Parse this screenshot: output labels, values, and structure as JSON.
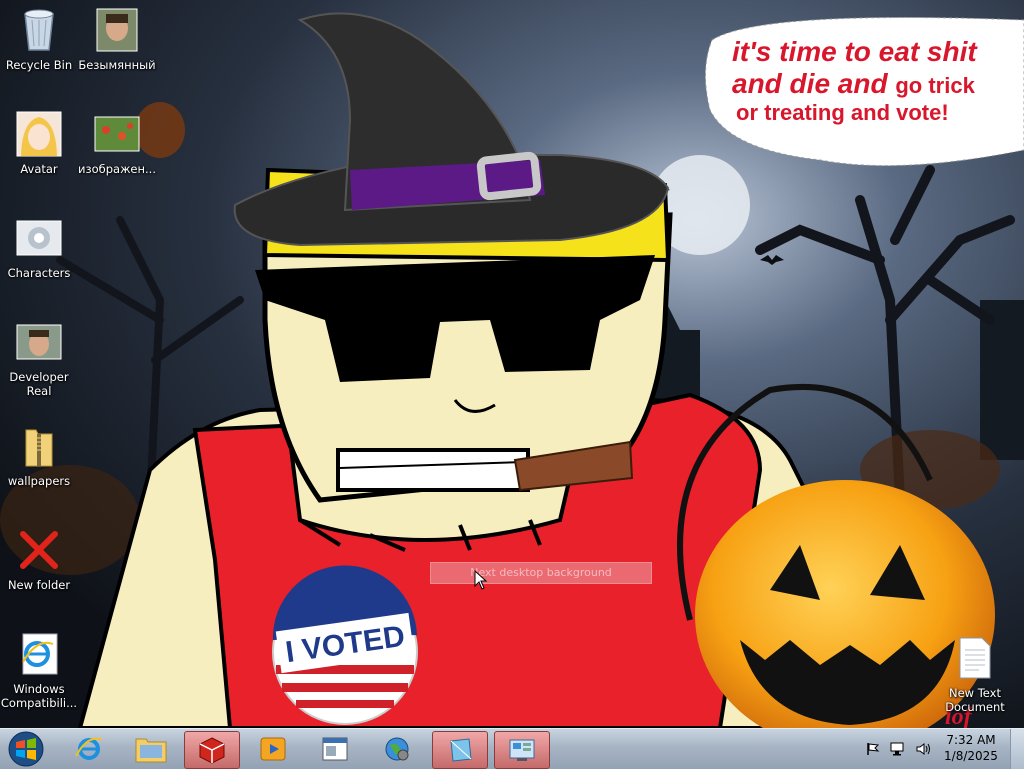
{
  "desktop": {
    "icons": [
      {
        "label": "Recycle Bin",
        "icon": "recycle-bin-icon"
      },
      {
        "label": "Безымянный",
        "icon": "photo-thumbnail-icon"
      },
      {
        "label": "Avatar",
        "icon": "anime-avatar-icon"
      },
      {
        "label": "изображен...",
        "icon": "photo-thumbnail-icon"
      },
      {
        "label": "Characters",
        "icon": "characters-icon"
      },
      {
        "label": "Developer Real",
        "icon": "photo-thumbnail-icon"
      },
      {
        "label": "wallpapers",
        "icon": "zip-folder-icon"
      },
      {
        "label": "New folder",
        "icon": "red-x-icon"
      },
      {
        "label": "Windows Compatibili...",
        "icon": "internet-explorer-icon"
      },
      {
        "label": "New Text Document",
        "icon": "text-document-icon"
      }
    ]
  },
  "wallpaper": {
    "bubble_line1": "it's time to eat shit",
    "bubble_line2_big": "and die and",
    "bubble_line2_small": "go trick",
    "bubble_line3": "or treating and vote!",
    "badge_text": "I VOTED",
    "logo_text": "lof"
  },
  "tooltip": {
    "text": "Next desktop background"
  },
  "taskbar": {
    "start_icon": "windows-logo-icon",
    "pinned": [
      {
        "name": "internet-explorer",
        "icon": "internet-explorer-icon",
        "active": false
      },
      {
        "name": "file-explorer",
        "icon": "folder-icon",
        "active": false
      },
      {
        "name": "app-red-cube",
        "icon": "red-cube-icon",
        "active": true
      },
      {
        "name": "media-player",
        "icon": "media-player-icon",
        "active": false
      },
      {
        "name": "window-app",
        "icon": "window-app-icon",
        "active": false
      },
      {
        "name": "globe-app",
        "icon": "globe-icon",
        "active": false
      },
      {
        "name": "blue-diamond-app",
        "icon": "blue-diamond-icon",
        "active": true
      },
      {
        "name": "control-panel",
        "icon": "control-panel-icon",
        "active": true
      }
    ],
    "tray": {
      "flag_icon": "action-center-flag-icon",
      "network_icon": "network-icon",
      "volume_icon": "volume-icon"
    },
    "clock": {
      "time": "7:32 AM",
      "date": "1/8/2025"
    }
  },
  "colors": {
    "bubble_red": "#d8162c",
    "taskbar_active": "#c46a6a",
    "tank_top_red": "#e8212b",
    "skin": "#f6eebf",
    "hair": "#f6e21a"
  }
}
